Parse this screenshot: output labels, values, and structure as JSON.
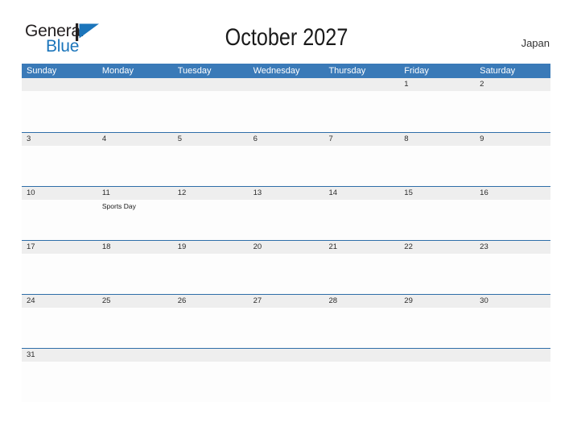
{
  "brand": {
    "name_top": "General",
    "name_bottom": "Blue",
    "mark_icon": "blue-flag-triangle-icon",
    "accent_color": "#1b75bb"
  },
  "header": {
    "title": "October 2027",
    "region": "Japan"
  },
  "theme": {
    "header_blue": "#3a7ab8",
    "row_line_blue": "#2f6ea8",
    "band_gray": "#eeeeee",
    "text_dark": "#2b2b2b"
  },
  "calendar": {
    "day_headers": [
      "Sunday",
      "Monday",
      "Tuesday",
      "Wednesday",
      "Thursday",
      "Friday",
      "Saturday"
    ],
    "weeks": [
      [
        {
          "day": "",
          "event": ""
        },
        {
          "day": "",
          "event": ""
        },
        {
          "day": "",
          "event": ""
        },
        {
          "day": "",
          "event": ""
        },
        {
          "day": "",
          "event": ""
        },
        {
          "day": "1",
          "event": ""
        },
        {
          "day": "2",
          "event": ""
        }
      ],
      [
        {
          "day": "3",
          "event": ""
        },
        {
          "day": "4",
          "event": ""
        },
        {
          "day": "5",
          "event": ""
        },
        {
          "day": "6",
          "event": ""
        },
        {
          "day": "7",
          "event": ""
        },
        {
          "day": "8",
          "event": ""
        },
        {
          "day": "9",
          "event": ""
        }
      ],
      [
        {
          "day": "10",
          "event": ""
        },
        {
          "day": "11",
          "event": "Sports Day"
        },
        {
          "day": "12",
          "event": ""
        },
        {
          "day": "13",
          "event": ""
        },
        {
          "day": "14",
          "event": ""
        },
        {
          "day": "15",
          "event": ""
        },
        {
          "day": "16",
          "event": ""
        }
      ],
      [
        {
          "day": "17",
          "event": ""
        },
        {
          "day": "18",
          "event": ""
        },
        {
          "day": "19",
          "event": ""
        },
        {
          "day": "20",
          "event": ""
        },
        {
          "day": "21",
          "event": ""
        },
        {
          "day": "22",
          "event": ""
        },
        {
          "day": "23",
          "event": ""
        }
      ],
      [
        {
          "day": "24",
          "event": ""
        },
        {
          "day": "25",
          "event": ""
        },
        {
          "day": "26",
          "event": ""
        },
        {
          "day": "27",
          "event": ""
        },
        {
          "day": "28",
          "event": ""
        },
        {
          "day": "29",
          "event": ""
        },
        {
          "day": "30",
          "event": ""
        }
      ],
      [
        {
          "day": "31",
          "event": ""
        },
        {
          "day": "",
          "event": ""
        },
        {
          "day": "",
          "event": ""
        },
        {
          "day": "",
          "event": ""
        },
        {
          "day": "",
          "event": ""
        },
        {
          "day": "",
          "event": ""
        },
        {
          "day": "",
          "event": ""
        }
      ]
    ]
  }
}
